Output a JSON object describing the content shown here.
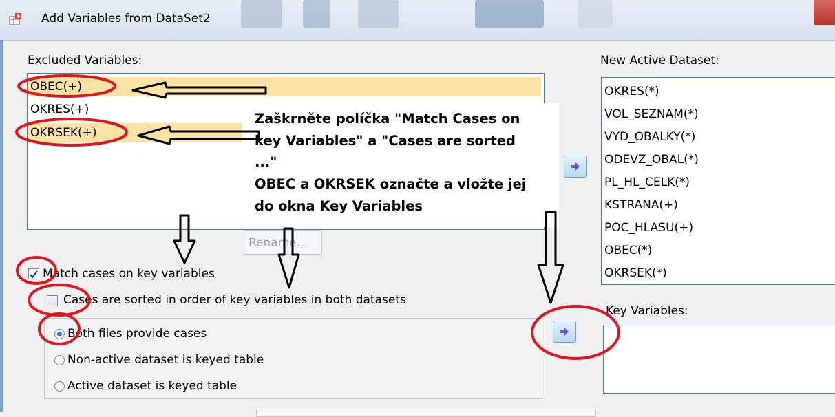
{
  "window": {
    "title": "Add Variables from DataSet2"
  },
  "excluded": {
    "label": "Excluded Variables:",
    "items": [
      "OBEC(+)",
      "OKRES(+)",
      "OKRSEK(+)"
    ]
  },
  "new_active": {
    "label": "New Active Dataset:",
    "items": [
      "OKRES(*)",
      "VOL_SEZNAM(*)",
      "VYD_OBALKY(*)",
      "ODEVZ_OBAL(*)",
      "PL_HL_CELK(*)",
      "KSTRANA(+)",
      "POC_HLASU(+)",
      "OBEC(*)",
      "OKRSEK(*)"
    ]
  },
  "rename_label": "Rename...",
  "options": {
    "match_label": "Match cases on key variables",
    "match_checked": true,
    "sorted_label": "Cases are sorted in order of key variables in both datasets",
    "sorted_checked": false,
    "radio": [
      {
        "label": "Both files provide cases",
        "checked": true
      },
      {
        "label": "Non-active dataset is keyed table",
        "checked": false
      },
      {
        "label": "Active dataset is keyed table",
        "checked": false
      }
    ]
  },
  "key_variables": {
    "label": "Key Variables:"
  },
  "annotation": {
    "lines": [
      "Zaškrněte políčka \"Match Cases on",
      "key Variables\" a \"Cases are sorted",
      "...\"",
      "OBEC a OKRSEK označte a vložte jej",
      "do okna Key Variables"
    ]
  },
  "colors": {
    "selection": "#fbe3a6",
    "list_border": "#3c7fb1",
    "annotation_red": "#e0141c",
    "arrow_button_glyph": "#6a4fd0"
  }
}
